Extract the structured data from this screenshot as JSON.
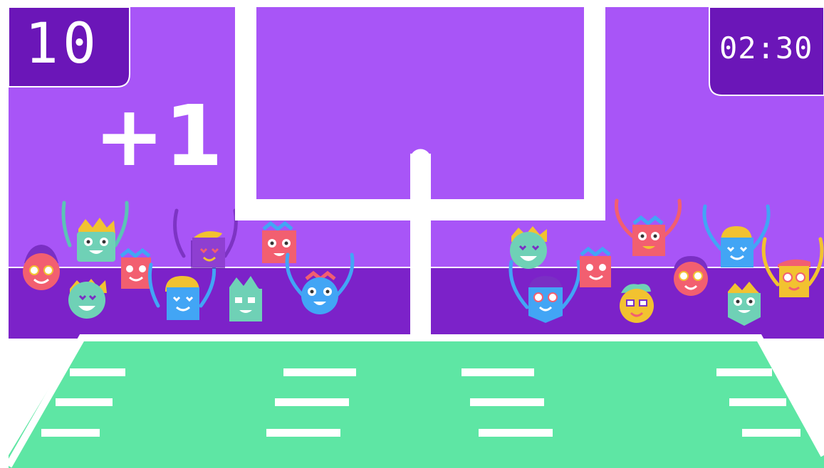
{
  "hud": {
    "score": "10",
    "timer": "02:30",
    "bonus": "+1"
  },
  "icons": {
    "goal": "goal-post-icon",
    "fans": "cheering-monster-icon"
  },
  "colors": {
    "sky": "#a855f7",
    "stands": "#7c22c9",
    "hud_panel": "#6b16b8",
    "field": "#5ee6a4",
    "lines": "#ffffff"
  }
}
